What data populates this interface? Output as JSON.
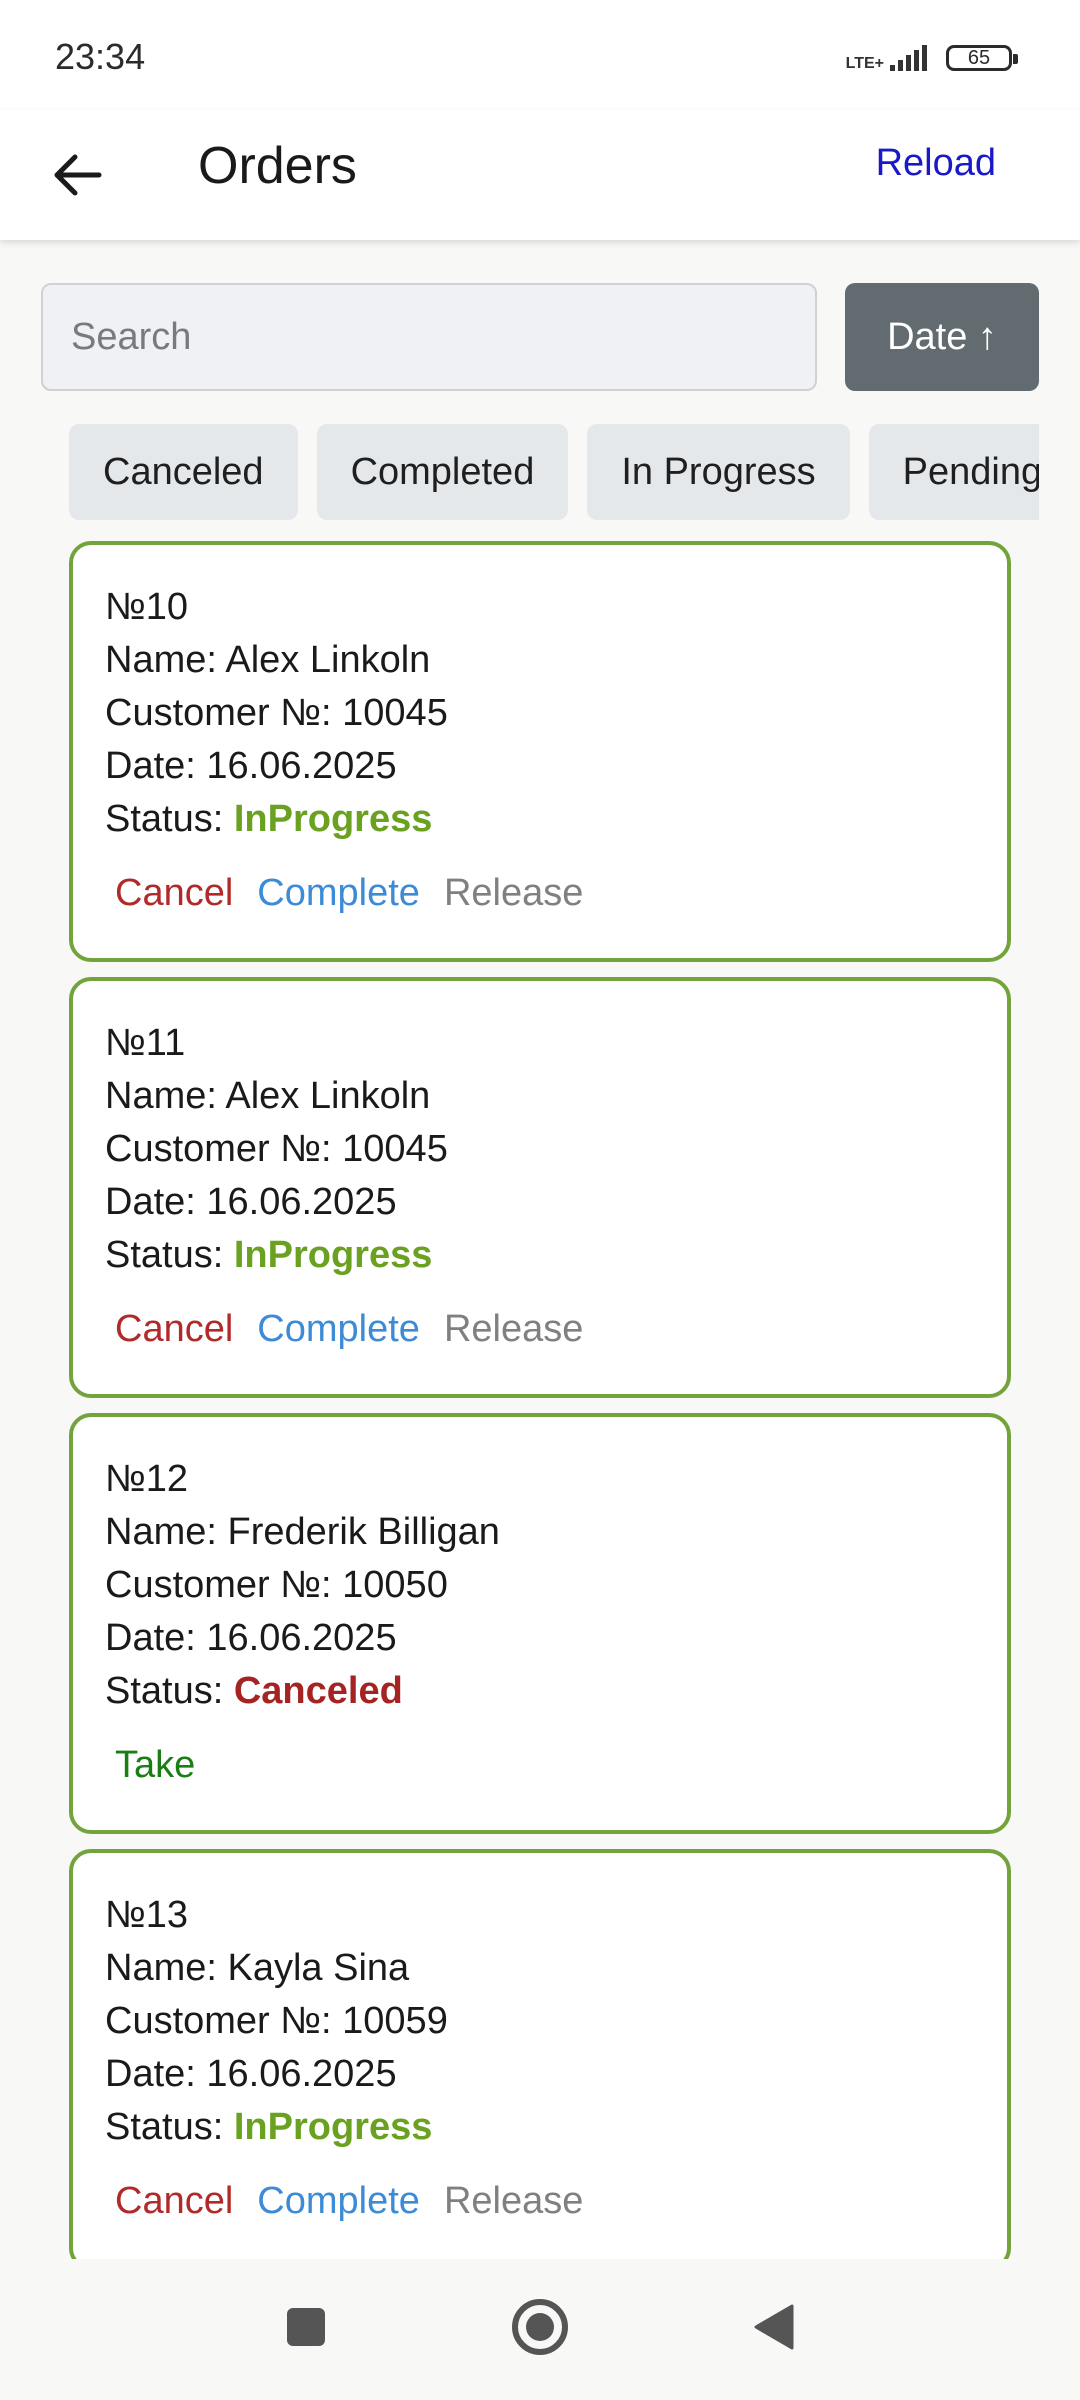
{
  "status_bar": {
    "time": "23:34",
    "network": "LTE+",
    "battery": "65"
  },
  "app_bar": {
    "title": "Orders",
    "reload_label": "Reload",
    "back_icon": "arrow-left-icon"
  },
  "search": {
    "placeholder": "Search",
    "value": "",
    "sort_label": "Date ↑"
  },
  "filters": [
    "Canceled",
    "Completed",
    "In Progress",
    "Pending"
  ],
  "labels": {
    "name": "Name: ",
    "customer": "Customer №: ",
    "date": "Date: ",
    "status": "Status: "
  },
  "orders": [
    {
      "number": "№10",
      "name": "Alex Linkoln",
      "customer": "10045",
      "date": "16.06.2025",
      "status": "InProgress",
      "actions": [
        "Cancel",
        "Complete",
        "Release"
      ]
    },
    {
      "number": "№11",
      "name": "Alex Linkoln",
      "customer": "10045",
      "date": "16.06.2025",
      "status": "InProgress",
      "actions": [
        "Cancel",
        "Complete",
        "Release"
      ]
    },
    {
      "number": "№12",
      "name": "Frederik Billigan",
      "customer": "10050",
      "date": "16.06.2025",
      "status": "Canceled",
      "actions": [
        "Take"
      ]
    },
    {
      "number": "№13",
      "name": "Kayla Sina",
      "customer": "10059",
      "date": "16.06.2025",
      "status": "InProgress",
      "actions": [
        "Cancel",
        "Complete",
        "Release"
      ]
    }
  ],
  "colors": {
    "card_border": "#72a33d",
    "status_inprogress": "#6aa121",
    "status_canceled": "#a52323",
    "action_cancel": "#b02a2a",
    "action_complete": "#3b8bd6",
    "action_release": "#808080",
    "action_take": "#1b7e14",
    "reload": "#1a19c8",
    "sort_button_bg": "#626c70"
  },
  "nav_bar": {
    "icons": [
      "square-icon",
      "home-circle-icon",
      "back-triangle-icon"
    ]
  }
}
